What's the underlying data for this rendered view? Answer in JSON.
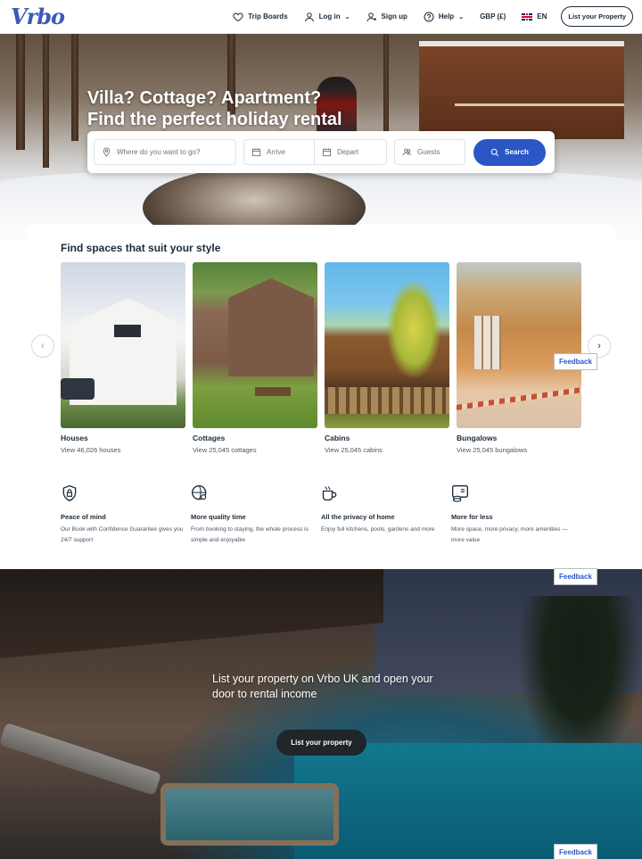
{
  "header": {
    "logo": "Vrbo",
    "nav": {
      "trip_boards": "Trip Boards",
      "log_in": "Log in",
      "sign_up": "Sign up",
      "help": "Help",
      "currency": "GBP (£)",
      "language": "EN",
      "list_property": "List your Property"
    }
  },
  "hero": {
    "title_line1": "Villa? Cottage? Apartment?",
    "title_line2": "Find the perfect holiday rental",
    "search": {
      "destination_placeholder": "Where do you want to go?",
      "arrive_placeholder": "Arrive",
      "depart_placeholder": "Depart",
      "guests_placeholder": "Guests",
      "button": "Search"
    }
  },
  "styles": {
    "title": "Find spaces that suit your style",
    "cards": [
      {
        "name": "Houses",
        "sub": "View 46,026 houses"
      },
      {
        "name": "Cottages",
        "sub": "View 25,045 cottages"
      },
      {
        "name": "Cabins",
        "sub": "View 25,045 cabins"
      },
      {
        "name": "Bungalows",
        "sub": "View 25,045 bungalows"
      }
    ]
  },
  "feedback_label": "Feedback",
  "benefits": [
    {
      "title": "Peace of mind",
      "desc": "Our Book with Confidence Guarantee gives you 24/7 support",
      "icon": "shield-lock-icon"
    },
    {
      "title": "More quality time",
      "desc": "From booking to staying, the whole process is simple and enjoyable",
      "icon": "family-globe-icon"
    },
    {
      "title": "All the privacy of home",
      "desc": "Enjoy full kitchens, pools, gardens and more",
      "icon": "mug-home-icon"
    },
    {
      "title": "More for less",
      "desc": "More space, more privacy, more amenities — more value",
      "icon": "coins-screen-icon"
    }
  ],
  "banner": {
    "text": "List your property on Vrbo UK and open your door to rental income",
    "button": "List your property"
  },
  "colors": {
    "brand_blue": "#2a56c6",
    "text_dark": "#1c2b39"
  }
}
